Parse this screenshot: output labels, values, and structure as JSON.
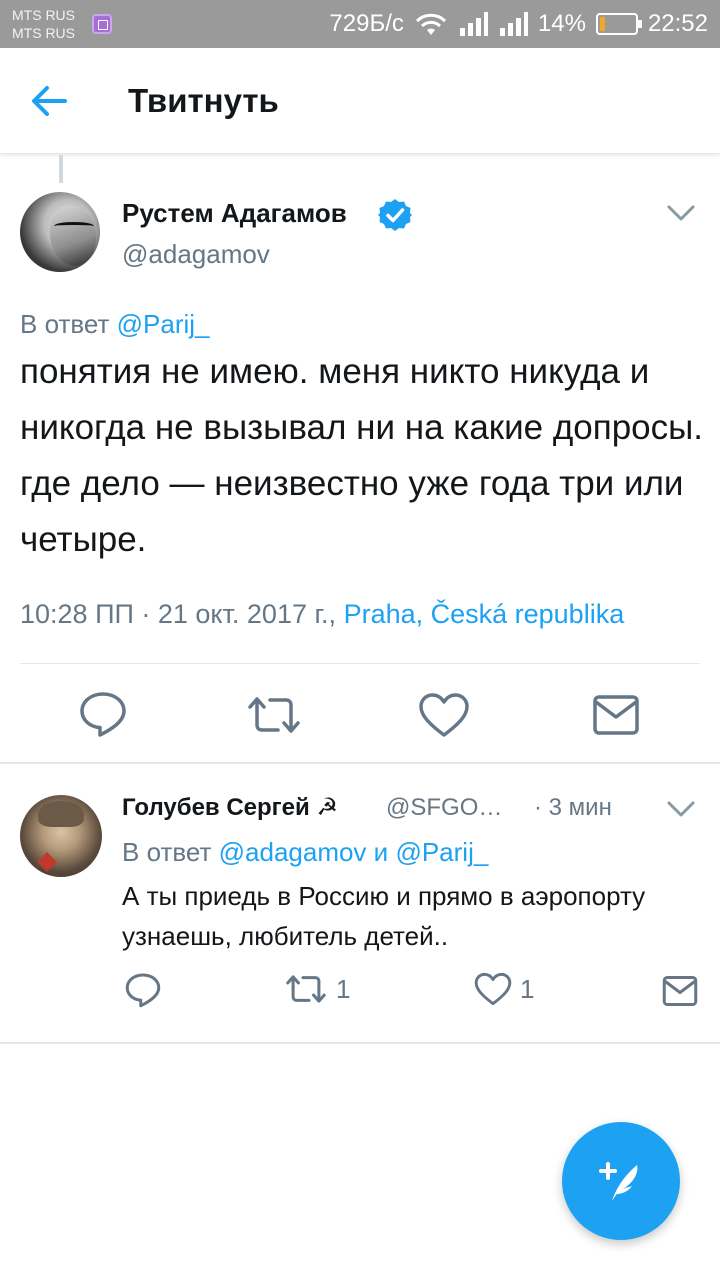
{
  "status_bar": {
    "carrier1": "MTS RUS",
    "carrier2": "MTS RUS",
    "speed": "729Б/с",
    "battery": "14%",
    "battery_level": 0.14,
    "time": "22:52"
  },
  "header": {
    "title": "Твитнуть",
    "back_icon": "arrow-left-icon"
  },
  "main_tweet": {
    "author_name": "Рустем Адагамов",
    "handle": "@adagamov",
    "verified": true,
    "reply_prefix": "В ответ",
    "reply_mention": "@Parij_",
    "text": "понятия не имею. меня никто никуда и никогда не вызывал ни на какие допросы. где дело — неизвестно уже года три или четыре.",
    "timestamp": "10:28 ПП · 21 окт. 2017 г.,",
    "location": "Praha, Česká republika",
    "actions": [
      "reply-icon",
      "retweet-icon",
      "like-icon",
      "direct-message-icon"
    ]
  },
  "reply_tweet": {
    "author_name": "Голубев Сергей ☭",
    "handle": "@SFGO…",
    "time": "· 3 мин",
    "reply_prefix": "В ответ",
    "mention1": "@adagamov",
    "conj": "и",
    "mention2": "@Parij_",
    "text": "А ты приедь в Россию и прямо в аэропорту узнаешь, любитель детей..",
    "retweet_count": "1",
    "like_count": "1"
  },
  "fab": {
    "icon": "compose-tweet-icon"
  },
  "colors": {
    "accent": "#1da1f2",
    "text": "#14171a",
    "muted": "#657786",
    "divider": "#e1e8ed"
  }
}
